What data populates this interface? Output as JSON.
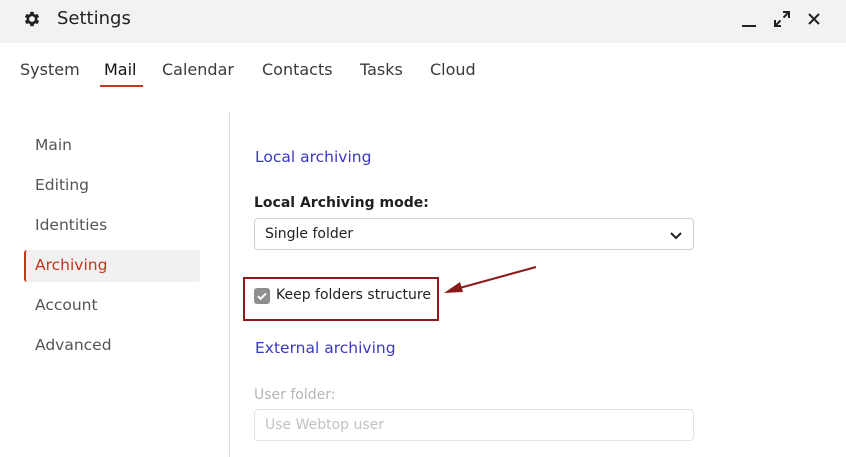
{
  "window": {
    "title": "Settings",
    "icons": {
      "app": "gear-icon",
      "minimize": "minimize-icon",
      "maximize": "maximize-icon",
      "close": "close-icon"
    }
  },
  "tabs": [
    {
      "label": "System",
      "active": false
    },
    {
      "label": "Mail",
      "active": true
    },
    {
      "label": "Calendar",
      "active": false
    },
    {
      "label": "Contacts",
      "active": false
    },
    {
      "label": "Tasks",
      "active": false
    },
    {
      "label": "Cloud",
      "active": false
    }
  ],
  "sidebar": {
    "items": [
      {
        "label": "Main",
        "active": false
      },
      {
        "label": "Editing",
        "active": false
      },
      {
        "label": "Identities",
        "active": false
      },
      {
        "label": "Archiving",
        "active": true
      },
      {
        "label": "Account",
        "active": false
      },
      {
        "label": "Advanced",
        "active": false
      }
    ]
  },
  "local_archiving": {
    "title": "Local archiving",
    "mode_label": "Local Archiving mode:",
    "mode_value": "Single folder",
    "keep_structure_label": "Keep folders structure",
    "keep_structure_checked": true
  },
  "external_archiving": {
    "title": "External archiving",
    "user_folder_label": "User folder:",
    "user_folder_placeholder": "Use Webtop user"
  },
  "colors": {
    "accent": "#c5341b",
    "section_title": "#3a39c4",
    "annotation": "#8b1a1a"
  }
}
